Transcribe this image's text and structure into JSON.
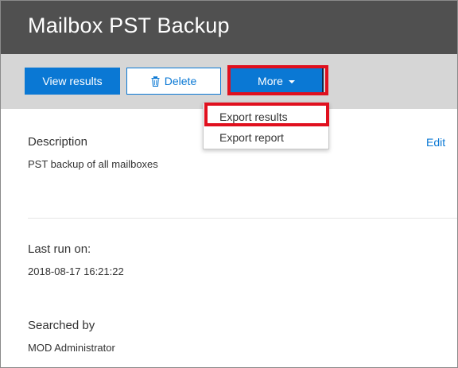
{
  "header": {
    "title": "Mailbox PST Backup"
  },
  "toolbar": {
    "view_results_label": "View results",
    "delete_label": "Delete",
    "delete_icon": "trash-icon",
    "more_label": "More"
  },
  "more_menu": {
    "items": [
      {
        "label": "Export results",
        "highlighted": true
      },
      {
        "label": "Export report"
      }
    ]
  },
  "details": {
    "description_label": "Description",
    "description_value": "PST backup of all mailboxes",
    "edit_label": "Edit",
    "last_run_label": "Last run on:",
    "last_run_value": "2018-08-17 16:21:22",
    "searched_by_label": "Searched by",
    "searched_by_value": "MOD Administrator"
  },
  "colors": {
    "title_bar": "#505050",
    "toolbar": "#d6d6d6",
    "accent": "#0a78d4",
    "highlight": "#e0101e"
  }
}
